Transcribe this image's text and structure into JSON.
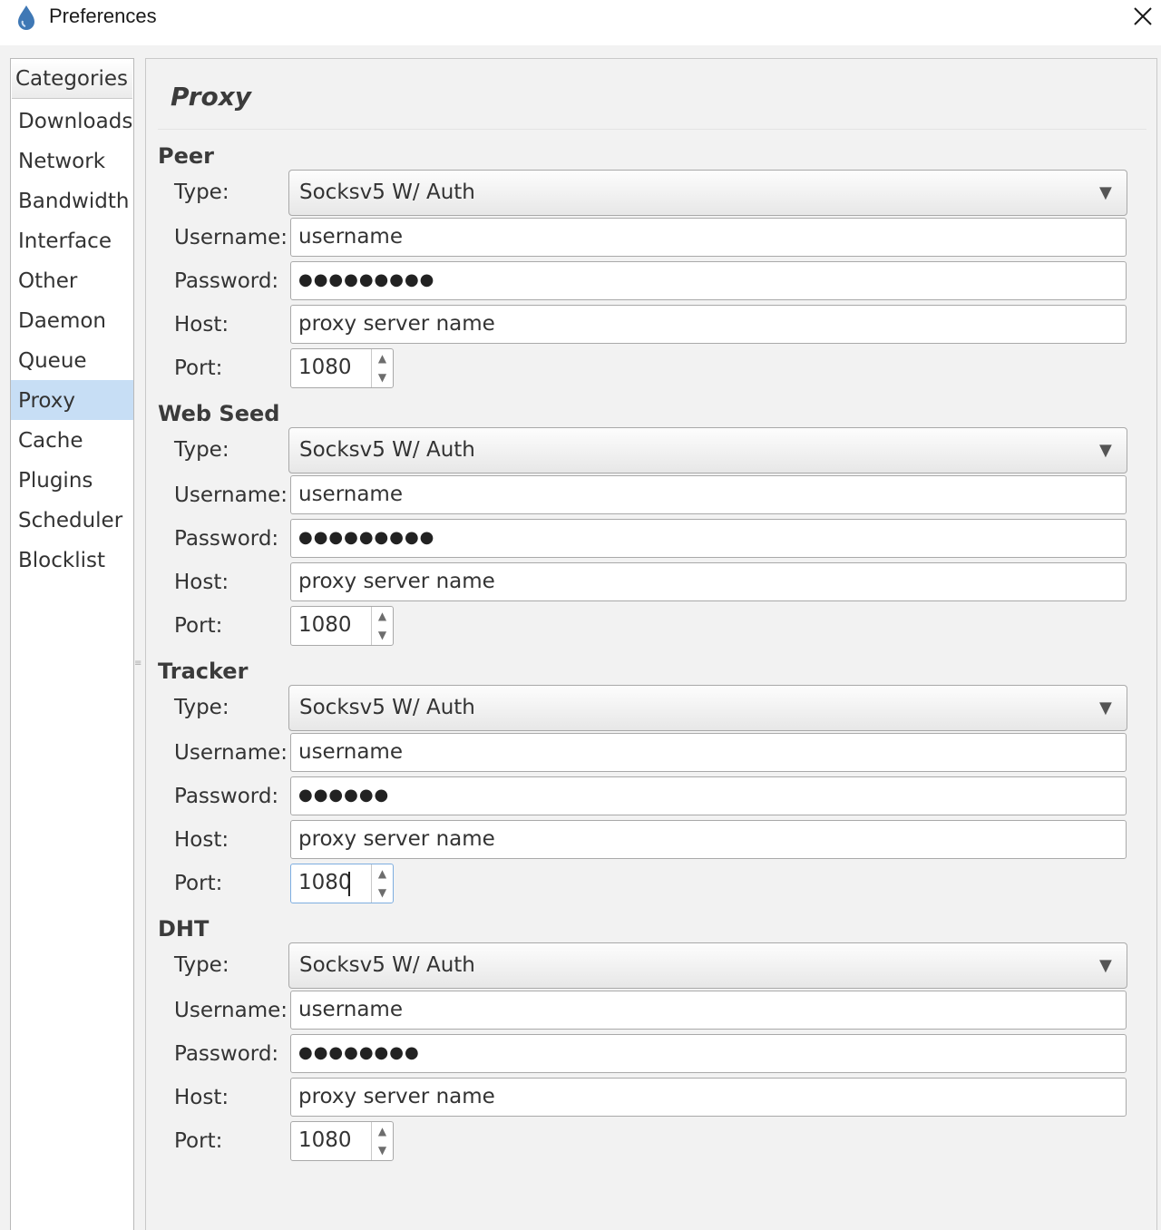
{
  "window": {
    "title": "Preferences"
  },
  "categories": {
    "header": "Categories",
    "items": [
      {
        "label": "Downloads"
      },
      {
        "label": "Network"
      },
      {
        "label": "Bandwidth"
      },
      {
        "label": "Interface"
      },
      {
        "label": "Other"
      },
      {
        "label": "Daemon"
      },
      {
        "label": "Queue"
      },
      {
        "label": "Proxy",
        "selected": true
      },
      {
        "label": "Cache"
      },
      {
        "label": "Plugins"
      },
      {
        "label": "Scheduler"
      },
      {
        "label": "Blocklist"
      }
    ]
  },
  "page": {
    "title": "Proxy"
  },
  "labels": {
    "type": "Type:",
    "username": "Username:",
    "password": "Password:",
    "host": "Host:",
    "port": "Port:"
  },
  "sections": [
    {
      "title": "Peer",
      "type": "Socksv5 W/ Auth",
      "username": "username",
      "password": "●●●●●●●●●",
      "host": "proxy server name",
      "port": "1080"
    },
    {
      "title": "Web Seed",
      "type": "Socksv5 W/ Auth",
      "username": "username",
      "password": "●●●●●●●●●",
      "host": "proxy server name",
      "port": "1080"
    },
    {
      "title": "Tracker",
      "type": "Socksv5 W/ Auth",
      "username": "username",
      "password": "●●●●●●",
      "host": "proxy server name",
      "port": "1080",
      "focused": true
    },
    {
      "title": "DHT",
      "type": "Socksv5 W/ Auth",
      "username": "username",
      "password": "●●●●●●●●",
      "host": "proxy server name",
      "port": "1080"
    }
  ],
  "icons": {
    "app": "droplet-icon",
    "close": "close-icon",
    "dropdown": "dropdown-arrow-icon",
    "spin_up": "spin-up-icon",
    "spin_down": "spin-down-icon"
  },
  "colors": {
    "selection": "#c7def5",
    "panel_background": "#f2f2f2",
    "app_icon": "#3f78b5"
  }
}
